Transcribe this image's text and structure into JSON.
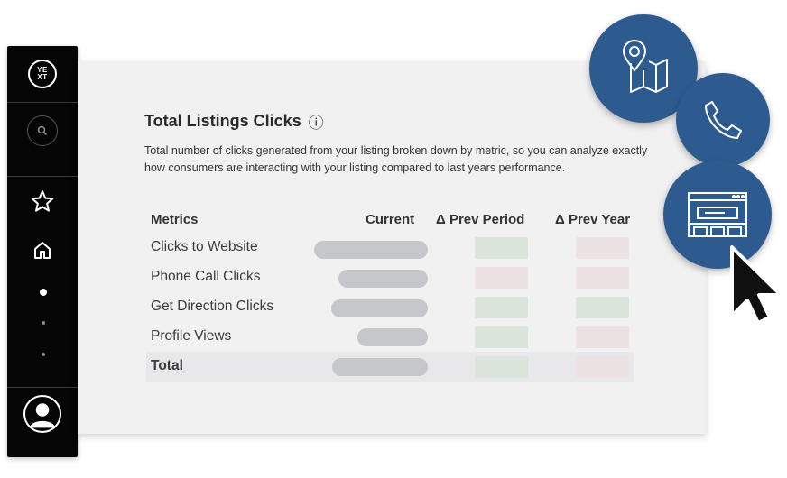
{
  "sidebar": {
    "logo_text": "YE XT",
    "icons": [
      "search-icon",
      "star-icon",
      "home-icon",
      "user-icon"
    ]
  },
  "card": {
    "title": "Total Listings Clicks",
    "info_glyph": "ⓘ",
    "description": "Total number of clicks generated from your listing broken down by metric, so you can analyze exactly how consumers are interacting with your listing compared to last years performance."
  },
  "table": {
    "headers": [
      "Metrics",
      "Current",
      "Δ Prev Period",
      "Δ Prev Year"
    ],
    "rows": [
      "Clicks to Website",
      "Phone Call Clicks",
      "Get Direction Clicks",
      "Profile Views",
      "Total"
    ]
  },
  "colors": {
    "sidebar_bg": "#050505",
    "bubble_blue": "#2e5b8f",
    "positive_cell": "#dbe5dc",
    "negative_cell": "#ede2e3",
    "placeholder_pill": "#c6c7cb"
  },
  "floating_icons": [
    "map-pin-icon",
    "phone-icon",
    "storefront-icon",
    "cursor-icon"
  ]
}
